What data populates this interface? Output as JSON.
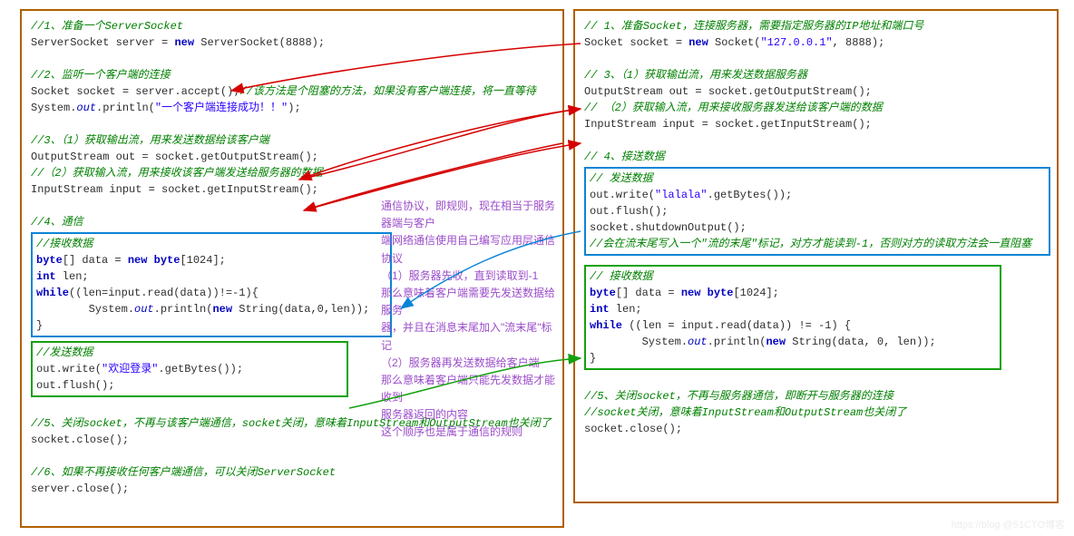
{
  "server": {
    "c1": "//1、准备一个ServerSocket",
    "s1a": "ServerSocket server = ",
    "s1b": " ServerSocket(8888);",
    "c2": "//2、监听一个客户端的连接",
    "s2": "Socket socket = server.accept();",
    "s2cm": "//该方法是个阻塞的方法，如果没有客户端连接，将一直等待",
    "s2p_a": "System.",
    "s2p_b": ".println(",
    "s2p_str": "\"一个客户端连接成功！！\"",
    "s2p_c": ");",
    "c3": "//3、（1）获取输出流，用来发送数据给该客户端",
    "s3": "OutputStream out = socket.getOutputStream();",
    "c3b": "//（2）获取输入流，用来接收该客户端发送给服务器的数据",
    "s3b": "InputStream input = socket.getInputStream();",
    "c4": "//4、通信",
    "rx_cm": "//接收数据",
    "rx1a": "byte",
    "rx1b": "[] data = ",
    "rx1c": " ",
    "rx1d": "byte",
    "rx1e": "[1024];",
    "rx2": " len;",
    "rx3a": "while",
    "rx3b": "((len=input.read(data))!=-1){",
    "rx4a": "        System.",
    "rx4b": ".println(",
    "rx4c": " String(data,0,len));",
    "rx5": "}",
    "tx_cm": "//发送数据",
    "tx1a": "out.write(",
    "tx1str": "\"欢迎登录\"",
    "tx1b": ".getBytes());",
    "tx2": "out.flush();",
    "c5": "//5、关闭socket，不再与该客户端通信，socket关闭，意味着InputStream和OutputStream也关闭了",
    "s5": "socket.close();",
    "c6": "//6、如果不再接收任何客户端通信，可以关闭ServerSocket",
    "s6": "server.close();"
  },
  "client": {
    "c1": "// 1、准备Socket，连接服务器，需要指定服务器的IP地址和端口号",
    "s1a": "Socket socket = ",
    "s1b": " Socket(",
    "s1ip": "\"127.0.0.1\"",
    "s1c": ", 8888);",
    "c3": "// 3、（1）获取输出流，用来发送数据服务器",
    "s3": "OutputStream out = socket.getOutputStream();",
    "c3b": "// （2）获取输入流，用来接收服务器发送给该客户端的数据",
    "s3b": "InputStream input = socket.getInputStream();",
    "c4": "// 4、接送数据",
    "tx_cm": "// 发送数据",
    "tx1a": "out.write(",
    "tx1str": "\"lalala\"",
    "tx1b": ".getBytes());",
    "tx2": "out.flush();",
    "tx3": "socket.shutdownOutput();",
    "tx3cm": "//会在流末尾写入一个\"流的末尾\"标记，对方才能读到-1，否则对方的读取方法会一直阻塞",
    "rx_cm": "// 接收数据",
    "rx1a": "byte",
    "rx1b": "[] data = ",
    "rx1c": " ",
    "rx1d": "byte",
    "rx1e": "[1024];",
    "rx2": " len;",
    "rx3a": "while",
    "rx3b": " ((len = input.read(data)) != -1) {",
    "rx4a": "        System.",
    "rx4b": ".println(",
    "rx4c": " String(data, 0, len));",
    "rx5": "}",
    "c5a": "//5、关闭socket，不再与服务器通信，即断开与服务器的连接",
    "c5b": "//socket关闭，意味着InputStream和OutputStream也关闭了",
    "s5": "socket.close();"
  },
  "anno": {
    "a1": "通信协议，即规则，现在相当于服务器端与客户",
    "a2": "端网络通信使用自己编写应用层通信协议",
    "a3": "（1）服务器先收，直到读取到-1",
    "a4": "那么意味着客户端需要先发送数据给服务",
    "a5": "器，并且在消息末尾加入\"流末尾\"标记",
    "a6": "（2）服务器再发送数据给客户端",
    "a7": "那么意味着客户端只能先发数据才能收到",
    "a8": "服务器返回的内容",
    "a9": "这个顺序也是属于通信的规则"
  },
  "keywords": {
    "new": "new",
    "out": "out",
    "int": "int"
  },
  "watermark": "https://blog @51CTO博客"
}
